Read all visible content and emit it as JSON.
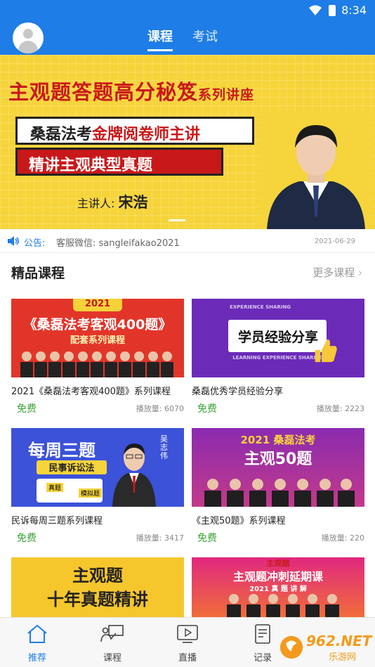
{
  "status_bar": {
    "time": "8:34"
  },
  "top_tabs": [
    {
      "label": "课程"
    },
    {
      "label": "考试"
    }
  ],
  "banner": {
    "title_main": "主观题答题高分秘笈",
    "title_small": "系列讲座",
    "line1_black": "桑磊法考",
    "line1_red": "金牌阅卷师主讲",
    "line2": "精讲主观典型真题",
    "lecturer_label": "主讲人:",
    "lecturer_name": "宋浩"
  },
  "notice": {
    "label": "公告:",
    "text": "客服微信: sangleifakao2021",
    "date": "2021-06-29"
  },
  "section": {
    "title": "精品课程",
    "more": "更多课程"
  },
  "courses": [
    {
      "title": "2021《桑磊法考客观400题》系列课程",
      "price": "免费",
      "plays": "播放量: 6070",
      "thumb_top": "2021",
      "thumb_main": "《桑磊法考客观400题》",
      "thumb_sub": "配套系列课程"
    },
    {
      "title": "桑磊优秀学员经验分享",
      "price": "免费",
      "plays": "播放量: 2223",
      "thumb_small": "EXPERIENCE SHARING",
      "thumb_main": "学员经验分享",
      "thumb_sub": "LEARNING EXPERIENCE SHARING"
    },
    {
      "title": "民诉每周三题系列课程",
      "price": "免费",
      "plays": "播放量: 3417",
      "thumb_main": "每周三题",
      "thumb_sub": "民事诉讼法",
      "thumb_name": "吴志伟",
      "thumb_tag1": "真题",
      "thumb_tag2": "模拟题"
    },
    {
      "title": "《主观50题》系列课程",
      "price": "免费",
      "plays": "播放量: 220",
      "thumb_top": "2021 桑磊法考",
      "thumb_main": "主观50题"
    },
    {
      "thumb_main": "主观题",
      "thumb_sub": "十年真题精讲"
    },
    {
      "thumb_top": "主观题",
      "thumb_main": "主观题冲刺延期课",
      "thumb_sub": "2021 真 题 讲 解"
    }
  ],
  "bottom_nav": [
    {
      "label": "推荐",
      "icon": "home-icon"
    },
    {
      "label": "课程",
      "icon": "classroom-icon"
    },
    {
      "label": "直播",
      "icon": "live-icon"
    },
    {
      "label": "记录",
      "icon": "record-icon"
    }
  ],
  "watermark": {
    "text": "962.NET",
    "sub": "乐游网"
  },
  "colors": {
    "brand_blue": "#1e7de6",
    "free_green": "#3aa335",
    "banner_yellow": "#f6d43b",
    "banner_red": "#c8191a"
  }
}
